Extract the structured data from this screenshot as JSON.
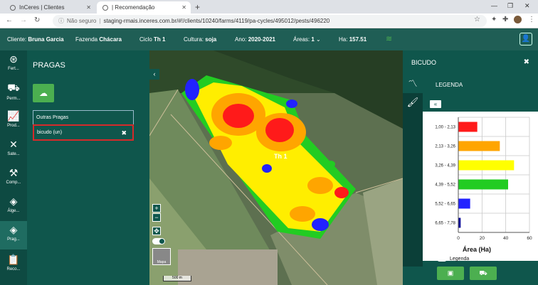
{
  "browser": {
    "tabs": [
      {
        "label": "InCeres | Clientes"
      },
      {
        "label": "| Recomendação"
      }
    ],
    "security_label": "Não seguro",
    "url": "staging-rmais.inceres.com.br/#!/clients/10240/farms/4119/pa-cycles/495012/pests/496220"
  },
  "appbar": {
    "cliente_label": "Cliente:",
    "cliente": "Bruna Garcia",
    "fazenda_label": "Fazenda",
    "fazenda": "Chácara",
    "ciclo_label": "Ciclo",
    "ciclo": "Th 1",
    "cultura_label": "Cultura:",
    "cultura": "soja",
    "ano_label": "Ano:",
    "ano": "2020-2021",
    "areas_label": "Áreas:",
    "areas": "1",
    "ha_label": "Ha:",
    "ha": "157.51"
  },
  "sidebar": {
    "items": [
      {
        "label": "Fert..."
      },
      {
        "label": "Perm..."
      },
      {
        "label": "Prod..."
      },
      {
        "label": "Sate..."
      },
      {
        "label": "Comp..."
      },
      {
        "label": "Álge..."
      },
      {
        "label": "Prag..."
      },
      {
        "label": "Reco..."
      }
    ]
  },
  "pragas": {
    "title": "PRAGAS",
    "group": "Outras Pragas",
    "item": "bicudo (un)"
  },
  "map": {
    "field_label": "Th 1",
    "thumb_label": "Mapa",
    "scale_label": "500 m"
  },
  "right_panel": {
    "title": "BICUDO",
    "legend_title": "LEGENDA",
    "legend_toggle_label": "Legenda",
    "x_axis_title": "Área (Ha)"
  },
  "chart_data": {
    "type": "bar",
    "orientation": "horizontal",
    "categories": [
      "1,00 - 2,13",
      "2,13 - 3,26",
      "3,26 - 4,39",
      "4,39 - 5,52",
      "5,52 - 6,65",
      "6,65 - 7,78"
    ],
    "values": [
      16,
      35,
      47,
      42,
      10,
      2
    ],
    "colors": [
      "#ff1a1a",
      "#ffa500",
      "#ffff00",
      "#22cc22",
      "#2222ff",
      "#0a0a99"
    ],
    "xlabel": "Área (Ha)",
    "xlim": [
      0,
      60
    ],
    "xticks": [
      0,
      20,
      40,
      60
    ],
    "grid": true
  }
}
